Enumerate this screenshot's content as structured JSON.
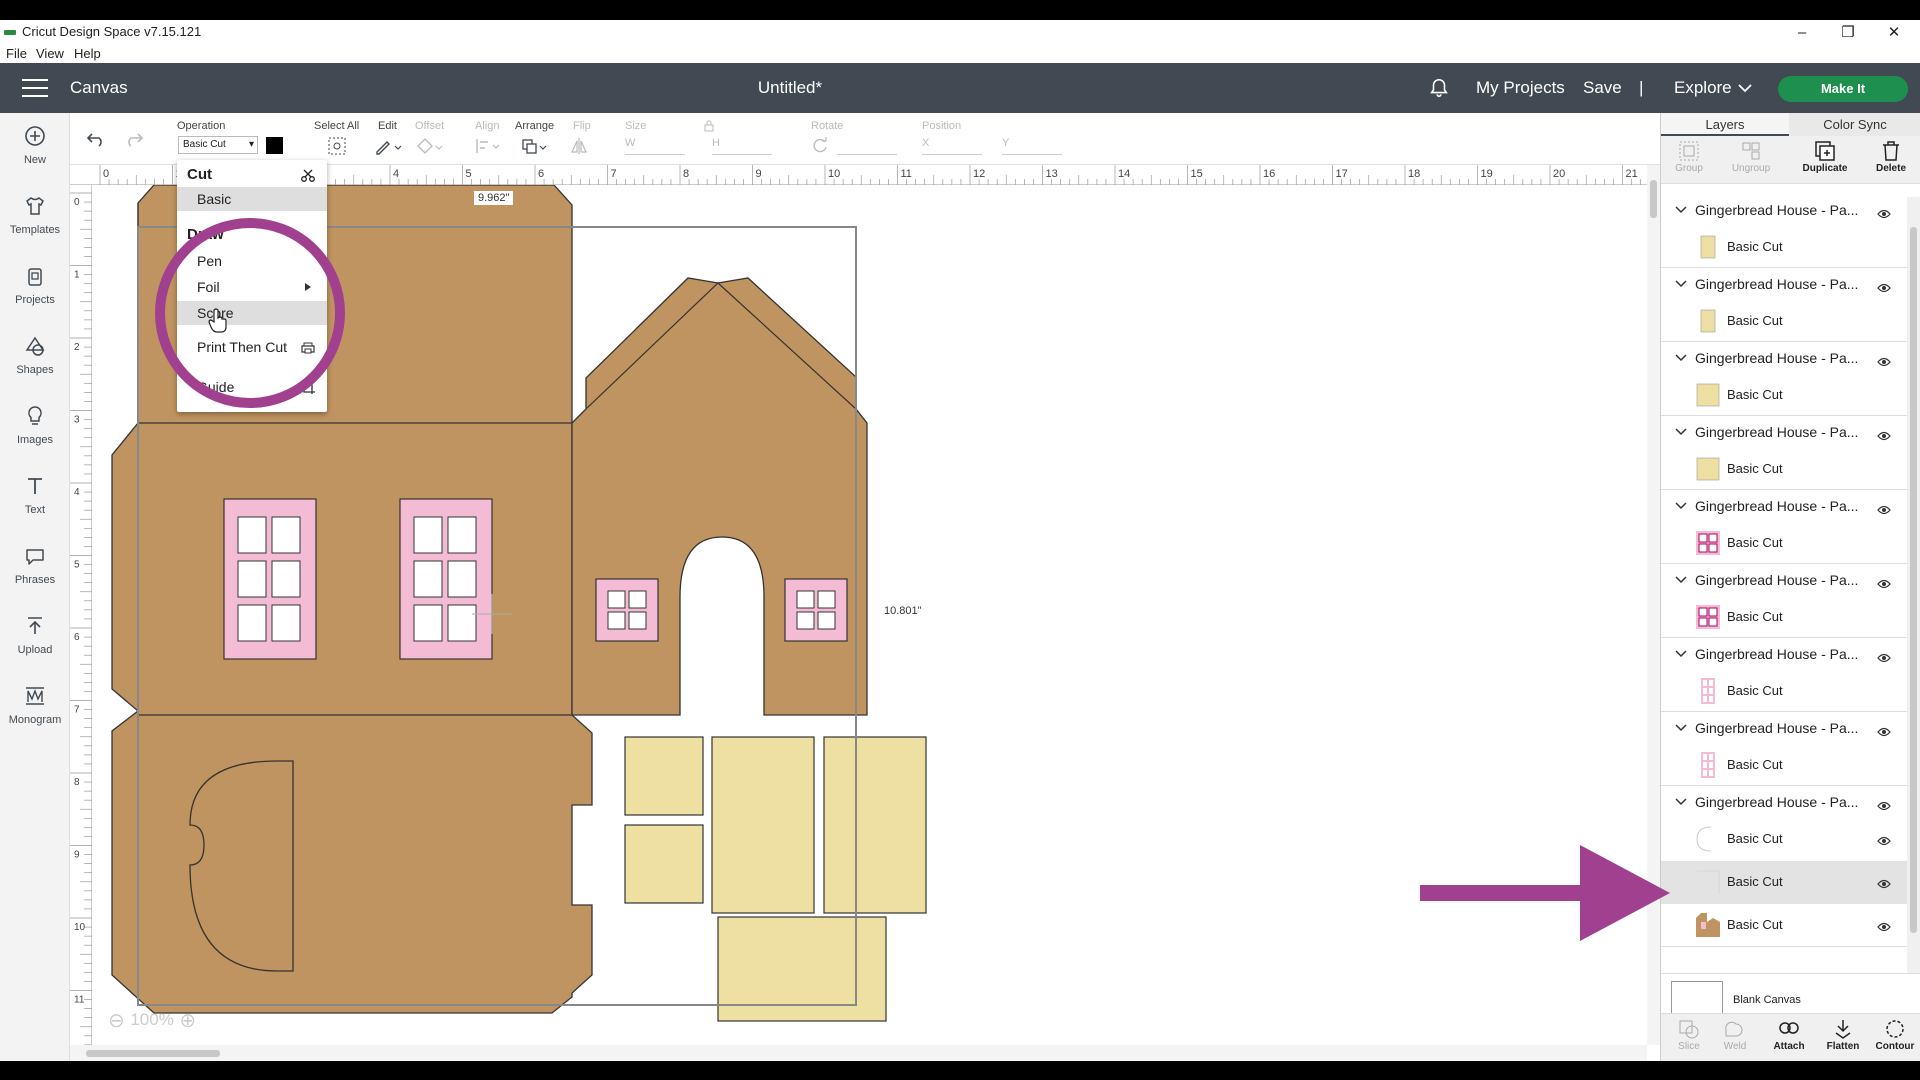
{
  "window": {
    "title": "Cricut Design Space v7.15.121",
    "menus": [
      "File",
      "View",
      "Help"
    ],
    "controls": [
      "–",
      "❐",
      "✕"
    ]
  },
  "header": {
    "section": "Canvas",
    "document_title": "Untitled*",
    "links": [
      "My Projects",
      "Save",
      "|",
      "Explore"
    ],
    "make_it": "Make It"
  },
  "left_toolbar": [
    "New",
    "Templates",
    "Projects",
    "Shapes",
    "Images",
    "Text",
    "Phrases",
    "Upload",
    "Monogram"
  ],
  "edit_toolbar": {
    "operation_label": "Operation",
    "operation_value": "Basic Cut",
    "operation_color": "#000000",
    "select_all": "Select All",
    "edit": "Edit",
    "offset": "Offset",
    "align": "Align",
    "arrange": "Arrange",
    "flip": "Flip",
    "size": "Size",
    "size_w": "W",
    "size_h": "H",
    "rotate": "Rotate",
    "position": "Position",
    "pos_x": "X",
    "pos_y": "Y"
  },
  "ruler": {
    "horizontal": [
      "0",
      "1",
      "2",
      "3",
      "4",
      "5",
      "6",
      "7",
      "8",
      "9",
      "10",
      "11",
      "12",
      "13",
      "14",
      "15",
      "16",
      "17",
      "18",
      "19",
      "20",
      "21"
    ],
    "vertical": [
      "0",
      "1",
      "2",
      "3",
      "4",
      "5",
      "6",
      "7",
      "8",
      "9",
      "10",
      "11"
    ]
  },
  "canvas": {
    "width_label": "9.962\"",
    "height_label": "10.801\"",
    "zoom": "100%",
    "colors": {
      "gingerbread": "#c09460",
      "pink": "#f4bcd4",
      "cream": "#ede0a2",
      "outline": "#333333"
    }
  },
  "operation_menu": {
    "cut_header": "Cut",
    "basic": "Basic",
    "draw_header": "Draw",
    "pen": "Pen",
    "foil": "Foil",
    "score": "Score",
    "print_then_cut": "Print Then Cut",
    "guide": "Guide"
  },
  "right_panel": {
    "tabs": [
      "Layers",
      "Color Sync"
    ],
    "actions": [
      "Group",
      "Ungroup",
      "Duplicate",
      "Delete"
    ],
    "groups": [
      {
        "name": "Gingerbread House - Pa...",
        "layers": [
          "Basic Cut"
        ],
        "thumb": "cream"
      },
      {
        "name": "Gingerbread House - Pa...",
        "layers": [
          "Basic Cut"
        ],
        "thumb": "cream"
      },
      {
        "name": "Gingerbread House - Pa...",
        "layers": [
          "Basic Cut"
        ],
        "thumb": "cream"
      },
      {
        "name": "Gingerbread House - Pa...",
        "layers": [
          "Basic Cut"
        ],
        "thumb": "cream"
      },
      {
        "name": "Gingerbread House - Pa...",
        "layers": [
          "Basic Cut"
        ],
        "thumb": "window-small"
      },
      {
        "name": "Gingerbread House - Pa...",
        "layers": [
          "Basic Cut"
        ],
        "thumb": "window-small"
      },
      {
        "name": "Gingerbread House - Pa...",
        "layers": [
          "Basic Cut"
        ],
        "thumb": "window-tall"
      },
      {
        "name": "Gingerbread House - Pa...",
        "layers": [
          "Basic Cut"
        ],
        "thumb": "window-tall"
      },
      {
        "name": "Gingerbread House - Pa...",
        "layers": [
          "Basic Cut",
          "Basic Cut",
          "Basic Cut"
        ],
        "thumb": "house"
      }
    ],
    "blank_canvas": "Blank Canvas",
    "bottom_actions": [
      "Slice",
      "Weld",
      "Attach",
      "Flatten",
      "Contour"
    ]
  }
}
